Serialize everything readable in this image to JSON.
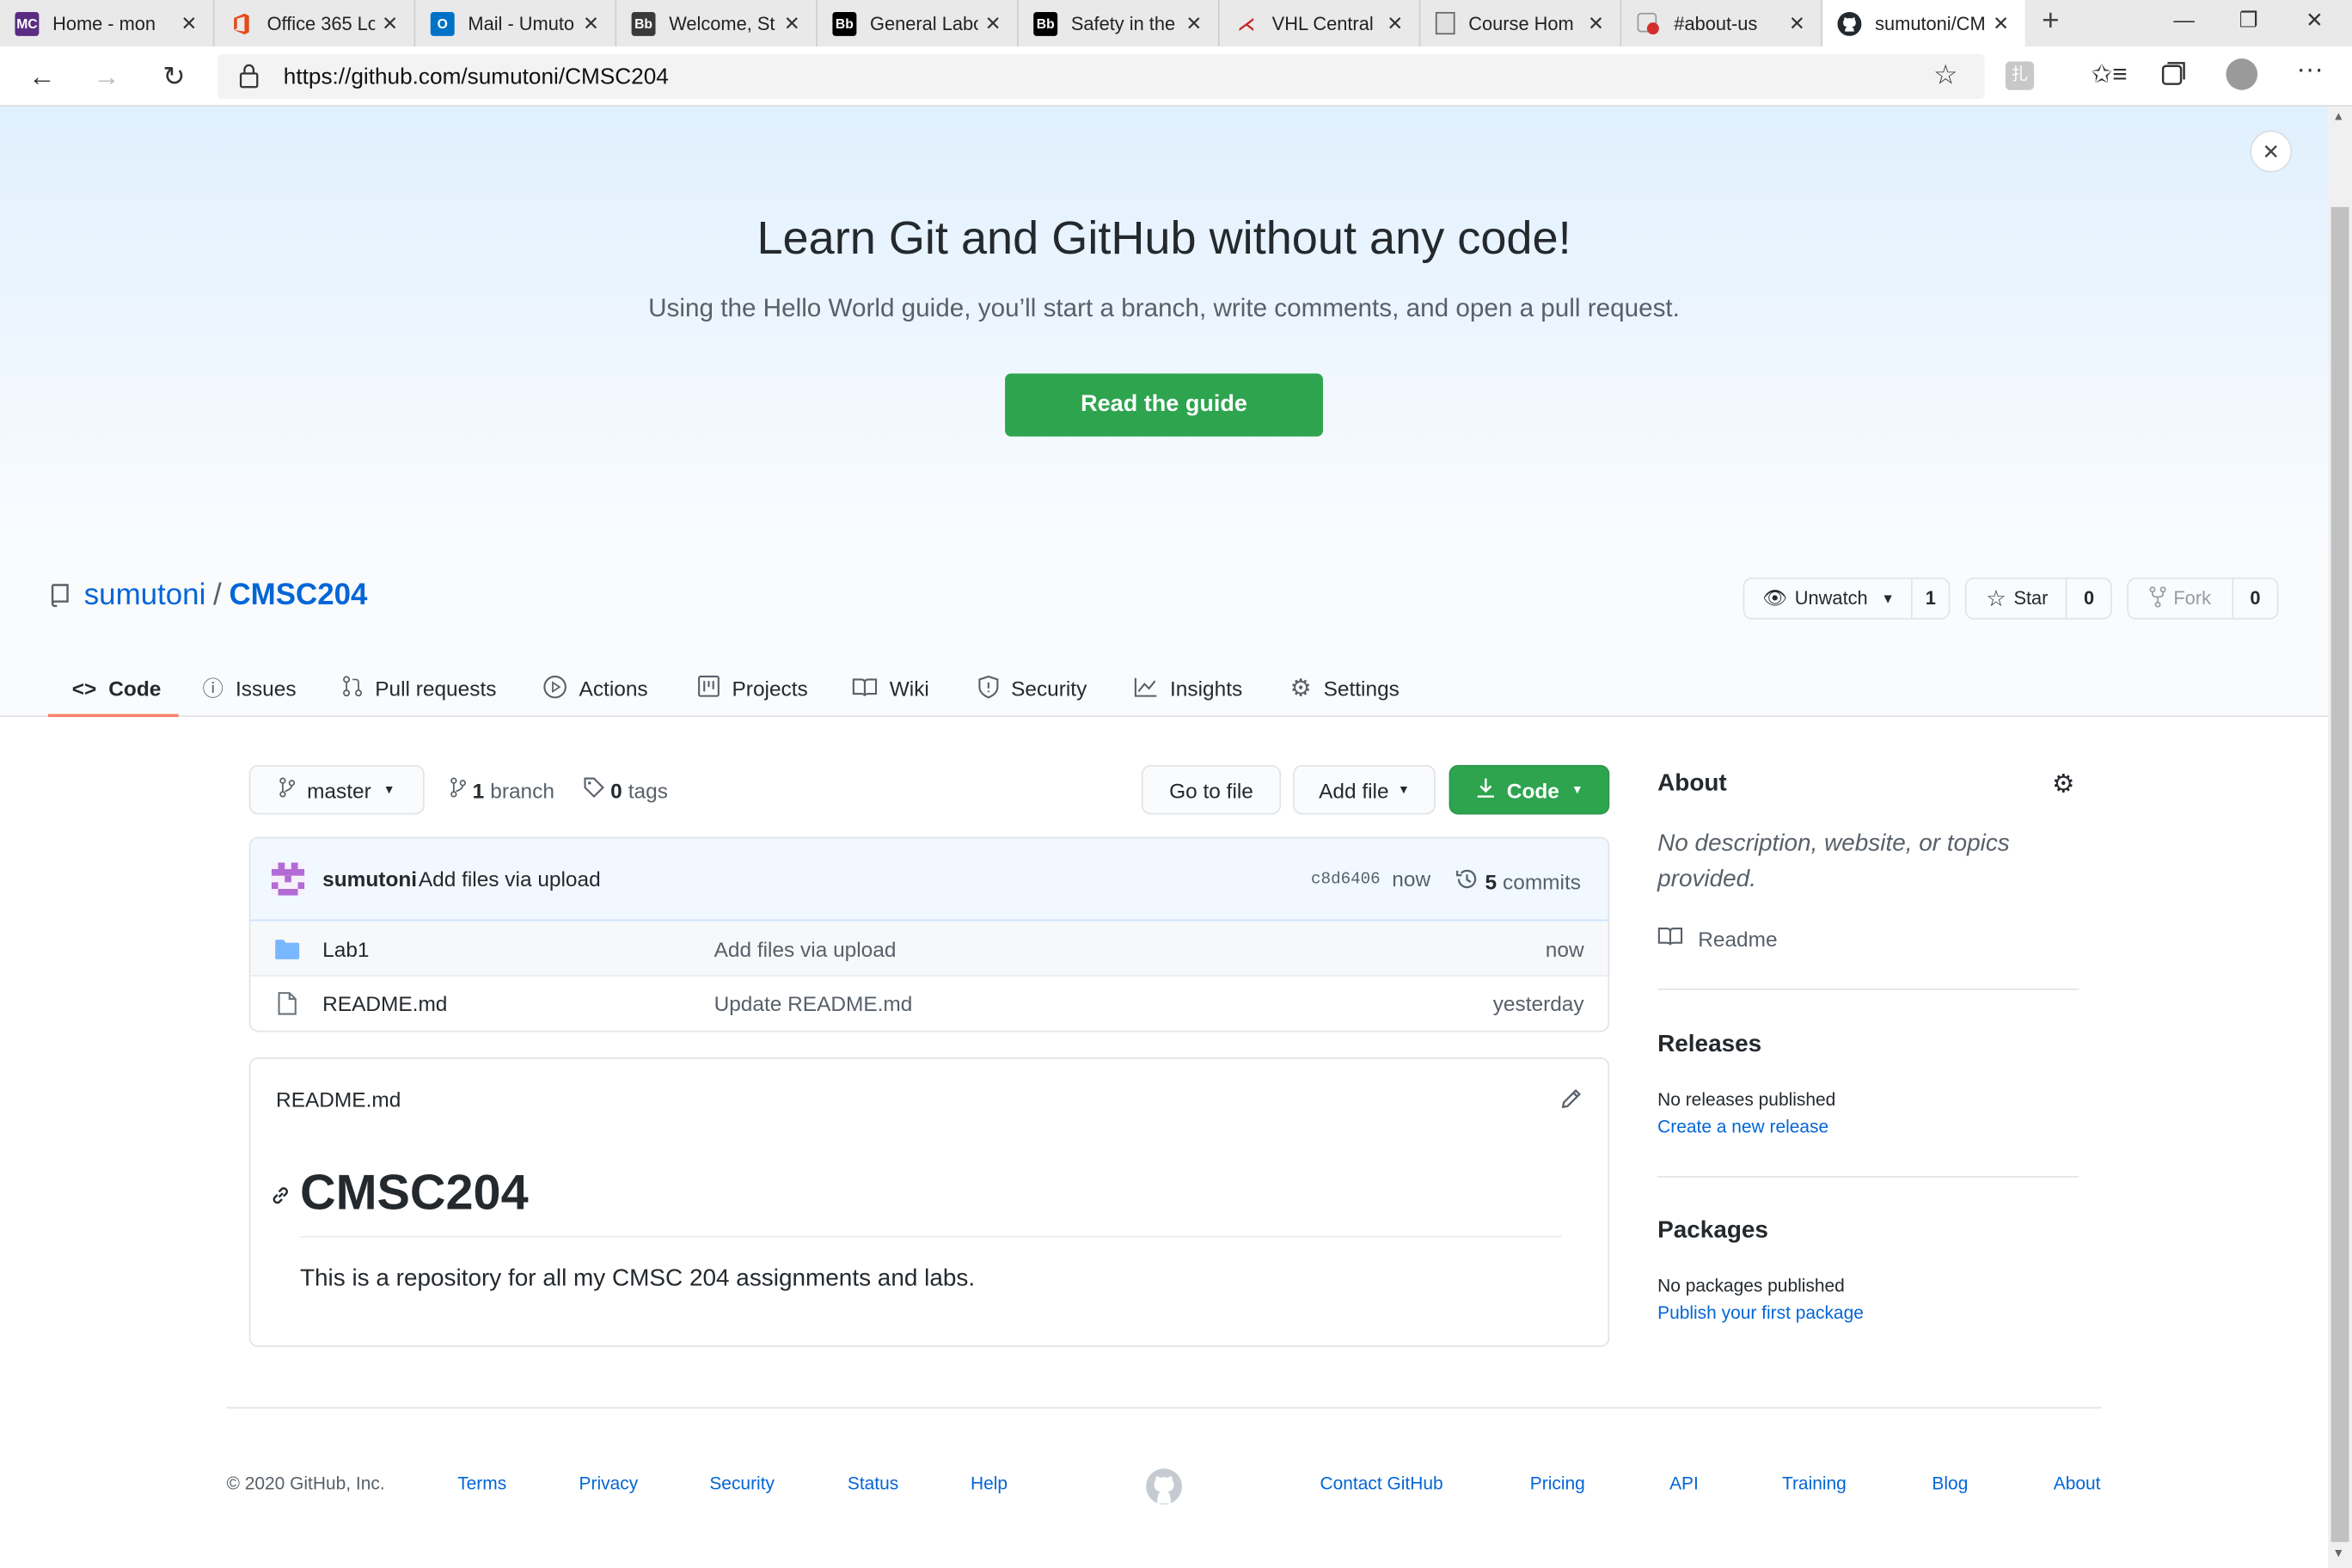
{
  "browser": {
    "tabs": [
      {
        "title": "Home - mon",
        "favicon": "MC",
        "favcolor": "#5a2d82"
      },
      {
        "title": "Office 365 Lo",
        "favicon": "O",
        "favcolor": "#e64a19"
      },
      {
        "title": "Mail - Umuto",
        "favicon": "O",
        "favcolor": "#0072c6"
      },
      {
        "title": "Welcome, St",
        "favicon": "Bb",
        "favcolor": "#222222"
      },
      {
        "title": "General Labo",
        "favicon": "Bb",
        "favcolor": "#000000"
      },
      {
        "title": "Safety in the",
        "favicon": "Bb",
        "favcolor": "#000000"
      },
      {
        "title": "VHL Central |",
        "favicon": "vhl",
        "favcolor": "#c62828"
      },
      {
        "title": "Course Hom",
        "favicon": "doc",
        "favcolor": "#666666"
      },
      {
        "title": "#about-us",
        "favicon": "rec",
        "favcolor": "#d32f2f"
      },
      {
        "title": "sumutoni/CM",
        "favicon": "gh",
        "favcolor": "#24292e"
      }
    ],
    "url": "https://github.com/sumutoni/CMSC204"
  },
  "banner": {
    "title": "Learn Git and GitHub without any code!",
    "subtitle": "Using the Hello World guide, you’ll start a branch, write comments, and open a pull request.",
    "cta": "Read the guide"
  },
  "repo": {
    "owner": "sumutoni",
    "separator": "/",
    "name": "CMSC204",
    "unwatch_label": "Unwatch",
    "watch_count": "1",
    "star_label": "Star",
    "star_count": "0",
    "fork_label": "Fork",
    "fork_count": "0"
  },
  "nav": [
    {
      "label": "Code",
      "icon": "code-icon"
    },
    {
      "label": "Issues",
      "icon": "issue-icon"
    },
    {
      "label": "Pull requests",
      "icon": "pull-request-icon"
    },
    {
      "label": "Actions",
      "icon": "play-icon"
    },
    {
      "label": "Projects",
      "icon": "project-icon"
    },
    {
      "label": "Wiki",
      "icon": "book-icon"
    },
    {
      "label": "Security",
      "icon": "shield-icon"
    },
    {
      "label": "Insights",
      "icon": "graph-icon"
    },
    {
      "label": "Settings",
      "icon": "gear-icon"
    }
  ],
  "toolbar": {
    "branch": "master",
    "branch_count": "1",
    "branch_word": "branch",
    "tag_count": "0",
    "tag_word": "tags",
    "go_to_file": "Go to file",
    "add_file": "Add file",
    "code": "Code"
  },
  "commit": {
    "author": "sumutoni",
    "message": "Add files via upload",
    "sha": "c8d6406",
    "time": "now",
    "count": "5",
    "count_word": "commits"
  },
  "files": [
    {
      "name": "Lab1",
      "type": "folder",
      "message": "Add files via upload",
      "time": "now"
    },
    {
      "name": "README.md",
      "type": "file",
      "message": "Update README.md",
      "time": "yesterday"
    }
  ],
  "readme": {
    "filename": "README.md",
    "heading": "CMSC204",
    "body": "This is a repository for all my CMSC 204 assignments and labs."
  },
  "about": {
    "title": "About",
    "description": "No description, website, or topics provided.",
    "readme_label": "Readme"
  },
  "releases": {
    "title": "Releases",
    "empty": "No releases published",
    "link": "Create a new release"
  },
  "packages": {
    "title": "Packages",
    "empty": "No packages published",
    "link": "Publish your first package"
  },
  "footer": {
    "copyright": "© 2020 GitHub, Inc.",
    "left_links": [
      "Terms",
      "Privacy",
      "Security",
      "Status",
      "Help"
    ],
    "right_links": [
      "Contact GitHub",
      "Pricing",
      "API",
      "Training",
      "Blog",
      "About"
    ]
  },
  "colors": {
    "primary_green": "#2ea44f",
    "link_blue": "#0366d6",
    "active_tab_underline": "#f9826c"
  }
}
